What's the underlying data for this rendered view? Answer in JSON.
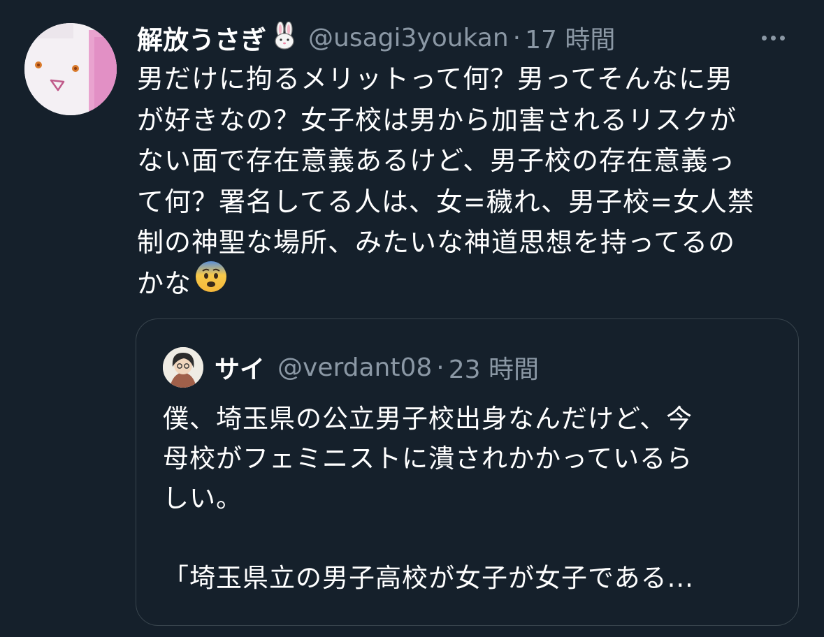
{
  "tweet": {
    "display_name": "解放うさぎ",
    "name_emoji": "🐰",
    "handle": "@usagi3youkan",
    "separator": "·",
    "time": "17 時間",
    "more_icon": "more-horizontal-icon",
    "body": "男だけに拘るメリットって何？男ってそんなに男\nが好きなの？女子校は男から加害されるリスクが\nない面で存在意義あるけど、男子校の存在意義っ\nて何？署名してる人は、女=穢れ、男子校=女人禁\n制の神聖な場所、みたいな神道思想を持ってるの\nかな",
    "body_emoji": "fearful-face-emoji"
  },
  "quoted_tweet": {
    "display_name": "サイ",
    "handle": "@verdant08",
    "separator": "·",
    "time": "23 時間",
    "body": "僕、埼玉県の公立男子校出身なんだけど、今\n母校がフェミニストに潰されかかっているら\nしい。",
    "quote_line": "「埼玉県立の男子高校が女子が女子である..."
  },
  "colors": {
    "background": "#15202b",
    "text": "#ffffff",
    "secondary": "#8b98a5",
    "border": "#38444d"
  }
}
